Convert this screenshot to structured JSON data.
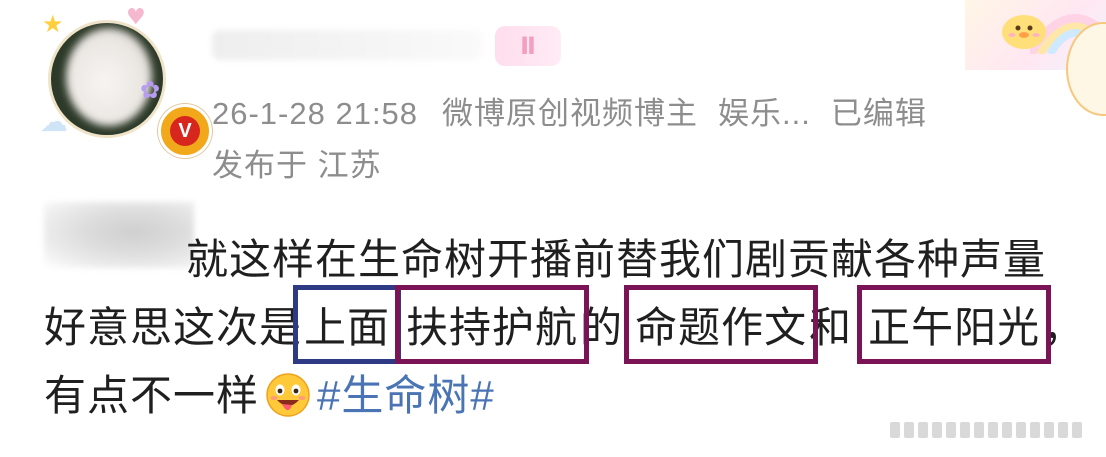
{
  "header": {
    "level_badge": "Ⅱ",
    "timestamp": "26-1-28 21:58",
    "tag": "微博原创视频博主",
    "category": "娱乐...",
    "edited": "已编辑",
    "location": "发布于 江苏",
    "verified_label": "V"
  },
  "post": {
    "line1": "就这样在生命树开播前替我们剧贡献各种声量",
    "line2_seg1": "好意思这次是",
    "line2_box1": "上面",
    "line2_box2": "扶持护航",
    "line2_seg2": "的",
    "line2_box3": "命题作文",
    "line2_seg3": "和",
    "line2_box4": "正午阳光",
    "line2_seg4": "，",
    "line3_seg1": "有点不一样",
    "topic": "#生命树#"
  },
  "icons": {
    "avatar": "avatar",
    "verified": "verified-badge-icon",
    "emoji": "drooling-face-emoji-icon",
    "decoration": "rainbow-chick-decoration"
  },
  "colors": {
    "meta_text": "#8d8d8d",
    "body_text": "#1f1f1f",
    "topic": "#4a74b4",
    "highlight_blue": "#2f3a85",
    "highlight_purple": "#7b1457",
    "verified": "#f2a81b"
  }
}
